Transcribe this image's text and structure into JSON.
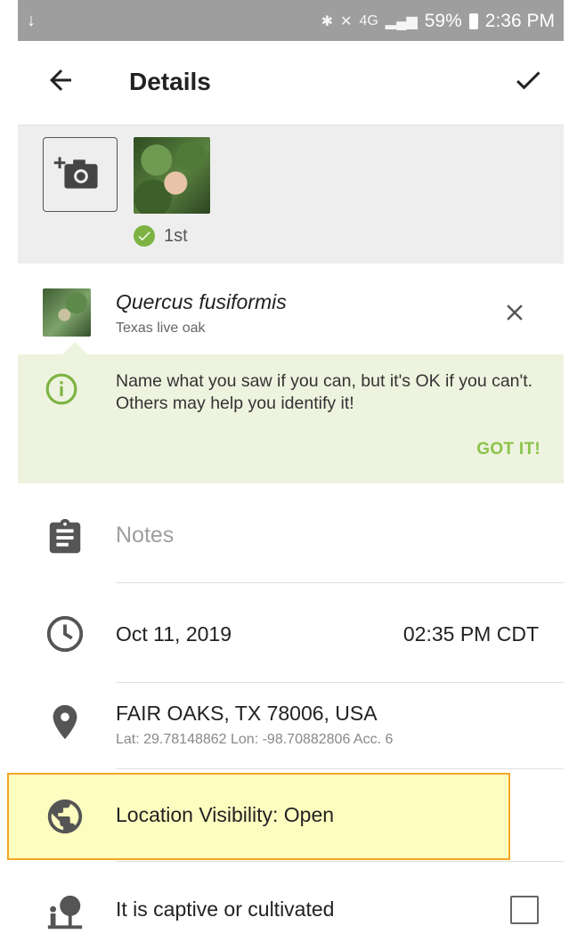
{
  "status_bar": {
    "download_icon": "↓",
    "battery": "59%",
    "time": "2:36 PM",
    "network": "4G"
  },
  "app_bar": {
    "title": "Details",
    "back_icon": "arrow-left-icon",
    "confirm_icon": "check-icon"
  },
  "photos": {
    "first_badge": "1st"
  },
  "species": {
    "scientific_name": "Quercus fusiformis",
    "common_name": "Texas live oak"
  },
  "tooltip": {
    "text": "Name what you saw if you can, but it's OK if you can't. Others may help you identify it!",
    "action": "GOT IT!"
  },
  "notes": {
    "placeholder": "Notes"
  },
  "datetime": {
    "date": "Oct 11, 2019",
    "time": "02:35 PM CDT"
  },
  "location": {
    "place": "FAIR OAKS, TX 78006, USA",
    "coords": "Lat: 29.78148862 Lon: -98.70882806 Acc. 6"
  },
  "visibility": {
    "label": "Location Visibility: Open"
  },
  "captive": {
    "label": "It is captive or cultivated",
    "checked": false
  },
  "colors": {
    "accent_green": "#8bc34a",
    "highlight": "#fefdc0",
    "highlight_border": "#f5a623",
    "tooltip_bg": "#eef3df"
  }
}
